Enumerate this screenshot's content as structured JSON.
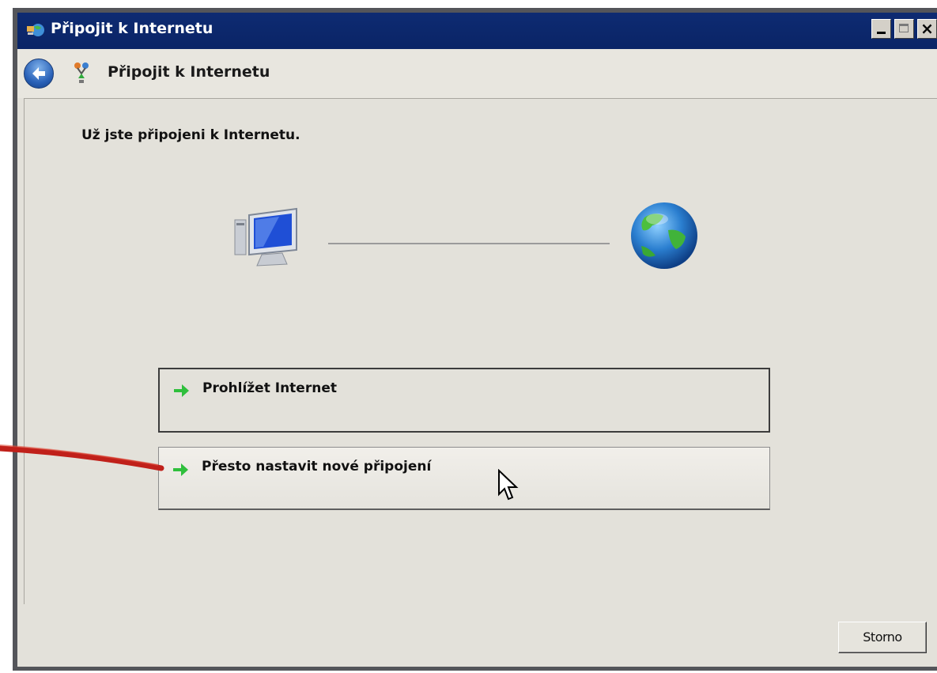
{
  "window": {
    "title": "Připojit k Internetu",
    "buttons": {
      "minimize": "minimize-icon",
      "maximize": "maximize-icon",
      "close": "close-icon"
    }
  },
  "navbar": {
    "back_icon": "back-arrow-icon",
    "title": "Připojit k Internetu"
  },
  "main": {
    "status_message": "Už jste připojeni k Internetu.",
    "diagram": {
      "left_icon": "computer-icon",
      "right_icon": "globe-icon"
    },
    "tasks": [
      {
        "label": "Prohlížet Internet",
        "icon": "green-arrow-icon"
      },
      {
        "label": "Přesto nastavit nové připojení",
        "icon": "green-arrow-icon"
      }
    ]
  },
  "footer": {
    "cancel_label": "Storno"
  },
  "colors": {
    "titlebar": "#0a2466",
    "window_frame": "#54555a",
    "client_bg": "#e3e1da",
    "accent_arrow": "#2fbf3c",
    "annotation_arrow": "#c0201a"
  }
}
